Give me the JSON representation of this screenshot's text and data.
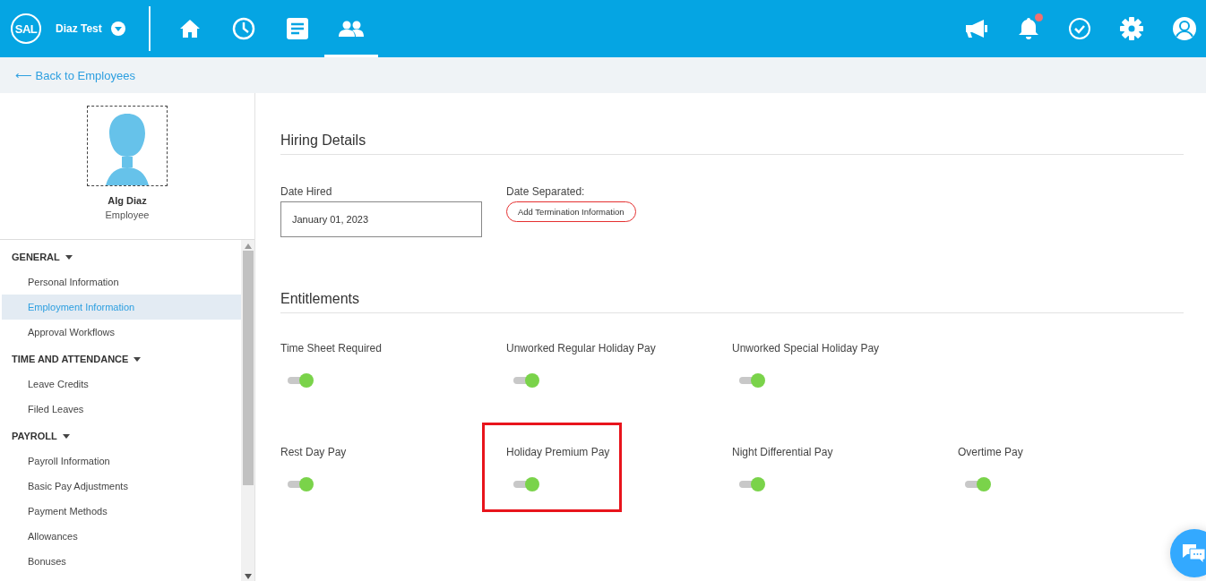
{
  "header": {
    "logo": "SAL",
    "company": "Diaz Test",
    "nav": [
      {
        "kind": "home",
        "selected": false
      },
      {
        "kind": "clock",
        "selected": false
      },
      {
        "kind": "document",
        "selected": false
      },
      {
        "kind": "people",
        "selected": true
      }
    ],
    "notifications_unread": true
  },
  "back_link": "⟵ Back to Employees",
  "profile": {
    "name": "Alg Diaz",
    "role": "Employee"
  },
  "sidebar": {
    "groups": [
      {
        "title": "GENERAL",
        "expanded": true,
        "items": [
          {
            "label": "Personal Information",
            "selected": false
          },
          {
            "label": "Employment Information",
            "selected": true
          },
          {
            "label": "Approval Workflows",
            "selected": false
          }
        ]
      },
      {
        "title": "TIME AND ATTENDANCE",
        "expanded": true,
        "items": [
          {
            "label": "Leave Credits",
            "selected": false
          },
          {
            "label": "Filed Leaves",
            "selected": false
          }
        ]
      },
      {
        "title": "PAYROLL",
        "expanded": true,
        "items": [
          {
            "label": "Payroll Information",
            "selected": false
          },
          {
            "label": "Basic Pay Adjustments",
            "selected": false
          },
          {
            "label": "Payment Methods",
            "selected": false
          },
          {
            "label": "Allowances",
            "selected": false
          },
          {
            "label": "Bonuses",
            "selected": false
          }
        ]
      }
    ]
  },
  "hiring": {
    "title": "Hiring Details",
    "date_hired_label": "Date Hired",
    "date_hired": "January 01, 2023",
    "date_separated_label": "Date Separated:",
    "termination_button": "Add Termination Information"
  },
  "entitlements": {
    "title": "Entitlements",
    "rows": [
      [
        {
          "label": "Time Sheet Required",
          "on": true,
          "highlighted": false
        },
        {
          "label": "Unworked Regular Holiday Pay",
          "on": true,
          "highlighted": false
        },
        {
          "label": "Unworked Special Holiday Pay",
          "on": true,
          "highlighted": false
        }
      ],
      [
        {
          "label": "Rest Day Pay",
          "on": true,
          "highlighted": false
        },
        {
          "label": "Holiday Premium Pay",
          "on": true,
          "highlighted": true
        },
        {
          "label": "Night Differential Pay",
          "on": true,
          "highlighted": false
        },
        {
          "label": "Overtime Pay",
          "on": true,
          "highlighted": false
        }
      ]
    ]
  }
}
